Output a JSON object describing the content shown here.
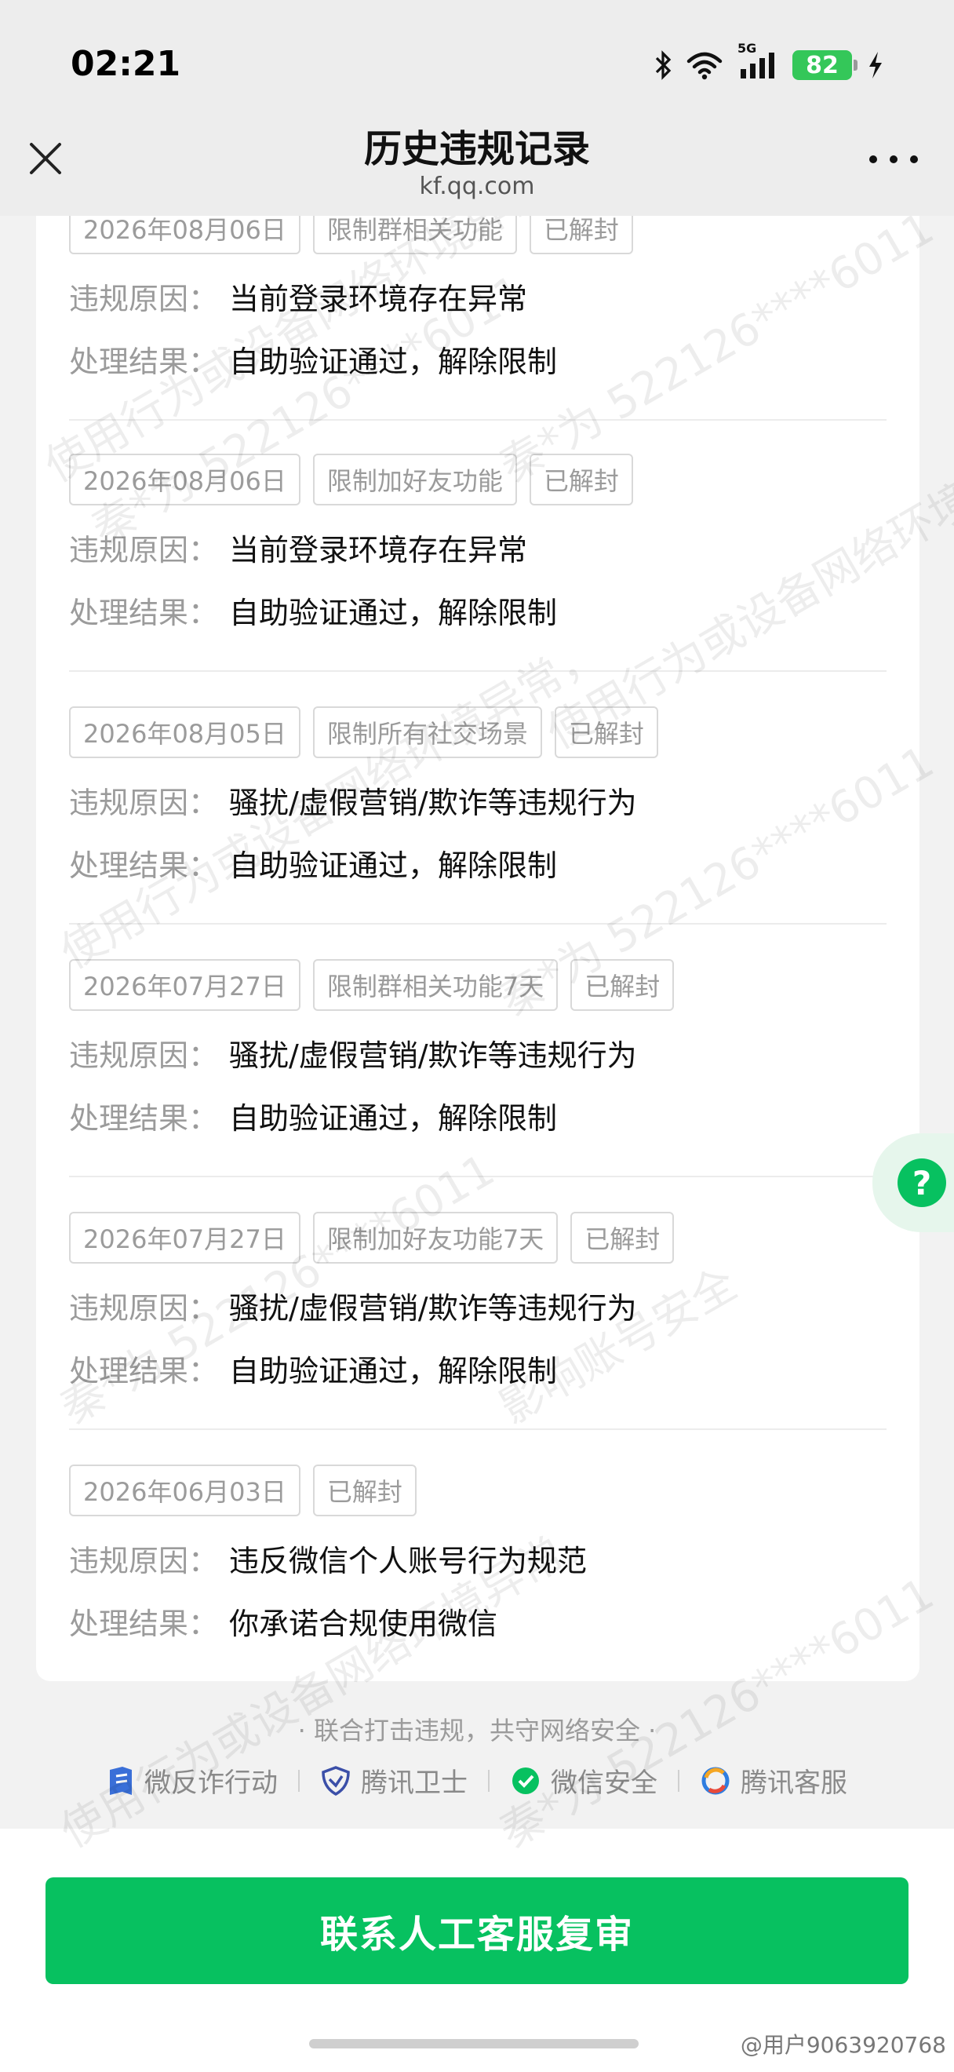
{
  "status_bar": {
    "time": "02:21",
    "network": "5G",
    "battery": "82"
  },
  "header": {
    "title": "历史违规记录",
    "url": "kf.qq.com"
  },
  "labels": {
    "reason": "违规原因：",
    "result": "处理结果："
  },
  "records": [
    {
      "date": "2026年08月06日",
      "restriction": "限制群相关功能",
      "status": "已解封",
      "reason": "当前登录环境存在异常",
      "result": "自助验证通过，解除限制"
    },
    {
      "date": "2026年08月06日",
      "restriction": "限制加好友功能",
      "status": "已解封",
      "reason": "当前登录环境存在异常",
      "result": "自助验证通过，解除限制"
    },
    {
      "date": "2026年08月05日",
      "restriction": "限制所有社交场景",
      "status": "已解封",
      "reason": "骚扰/虚假营销/欺诈等违规行为",
      "result": "自助验证通过，解除限制"
    },
    {
      "date": "2026年07月27日",
      "restriction": "限制群相关功能7天",
      "status": "已解封",
      "reason": "骚扰/虚假营销/欺诈等违规行为",
      "result": "自助验证通过，解除限制"
    },
    {
      "date": "2026年07月27日",
      "restriction": "限制加好友功能7天",
      "status": "已解封",
      "reason": "骚扰/虚假营销/欺诈等违规行为",
      "result": "自助验证通过，解除限制"
    },
    {
      "date": "2026年06月03日",
      "status": "已解封",
      "reason": "违反微信个人账号行为规范",
      "result": "你承诺合规使用微信"
    }
  ],
  "footer": {
    "slogan": "· 联合打击违规，共守网络安全 ·",
    "partners": [
      "微反诈行动",
      "腾讯卫士",
      "微信安全",
      "腾讯客服"
    ]
  },
  "cta": {
    "label": "联系人工客服复审"
  },
  "watermark": {
    "line1": "使用行为或设备网络环境异常，",
    "line2": "秦*为 522126****6011",
    "line3": "影响账号安全"
  },
  "credit": "@用户9063920768",
  "colors": {
    "primary_green": "#07c160",
    "tag_border": "#d9d9d9",
    "muted_text": "#9b9b9b"
  }
}
